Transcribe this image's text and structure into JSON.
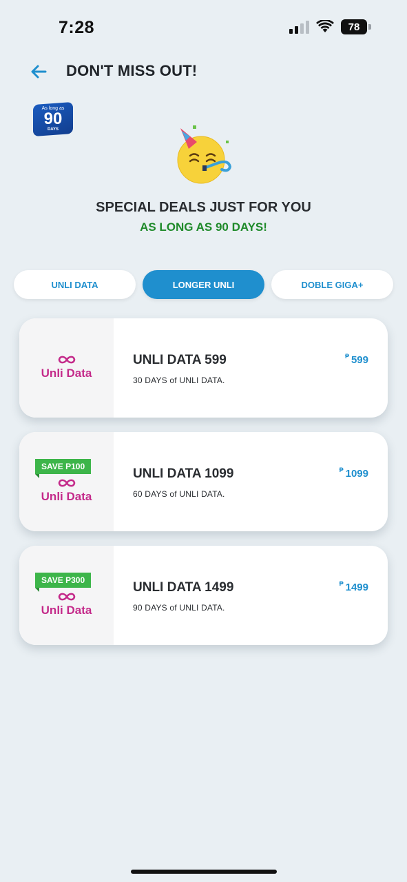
{
  "status_bar": {
    "time": "7:28",
    "battery": "78"
  },
  "header": {
    "title": "DON'T MISS OUT!"
  },
  "badge": {
    "top": "As long as",
    "number": "90",
    "bottom": "DAYS"
  },
  "promo": {
    "headline": "SPECIAL DEALS JUST FOR YOU",
    "subhead": "AS LONG AS 90 DAYS!"
  },
  "tabs": [
    {
      "label": "UNLI DATA",
      "active": false
    },
    {
      "label": "LONGER UNLI",
      "active": true
    },
    {
      "label": "DOBLE GIGA+",
      "active": false
    }
  ],
  "cards": [
    {
      "logo": "Unli Data",
      "save": "",
      "name": "UNLI DATA 599",
      "desc": "30 DAYS of UNLI DATA.",
      "currency": "₱",
      "price": "599"
    },
    {
      "logo": "Unli Data",
      "save": "SAVE P100",
      "name": "UNLI DATA 1099",
      "desc": "60 DAYS of UNLI DATA.",
      "currency": "₱",
      "price": "1099"
    },
    {
      "logo": "Unli Data",
      "save": "SAVE P300",
      "name": "UNLI DATA 1499",
      "desc": "90 DAYS of UNLI DATA.",
      "currency": "₱",
      "price": "1499"
    }
  ],
  "colors": {
    "accent": "#1f8fce",
    "green": "#1f8a2a",
    "brand_pink": "#c42a8a",
    "background": "#e9eff3"
  }
}
